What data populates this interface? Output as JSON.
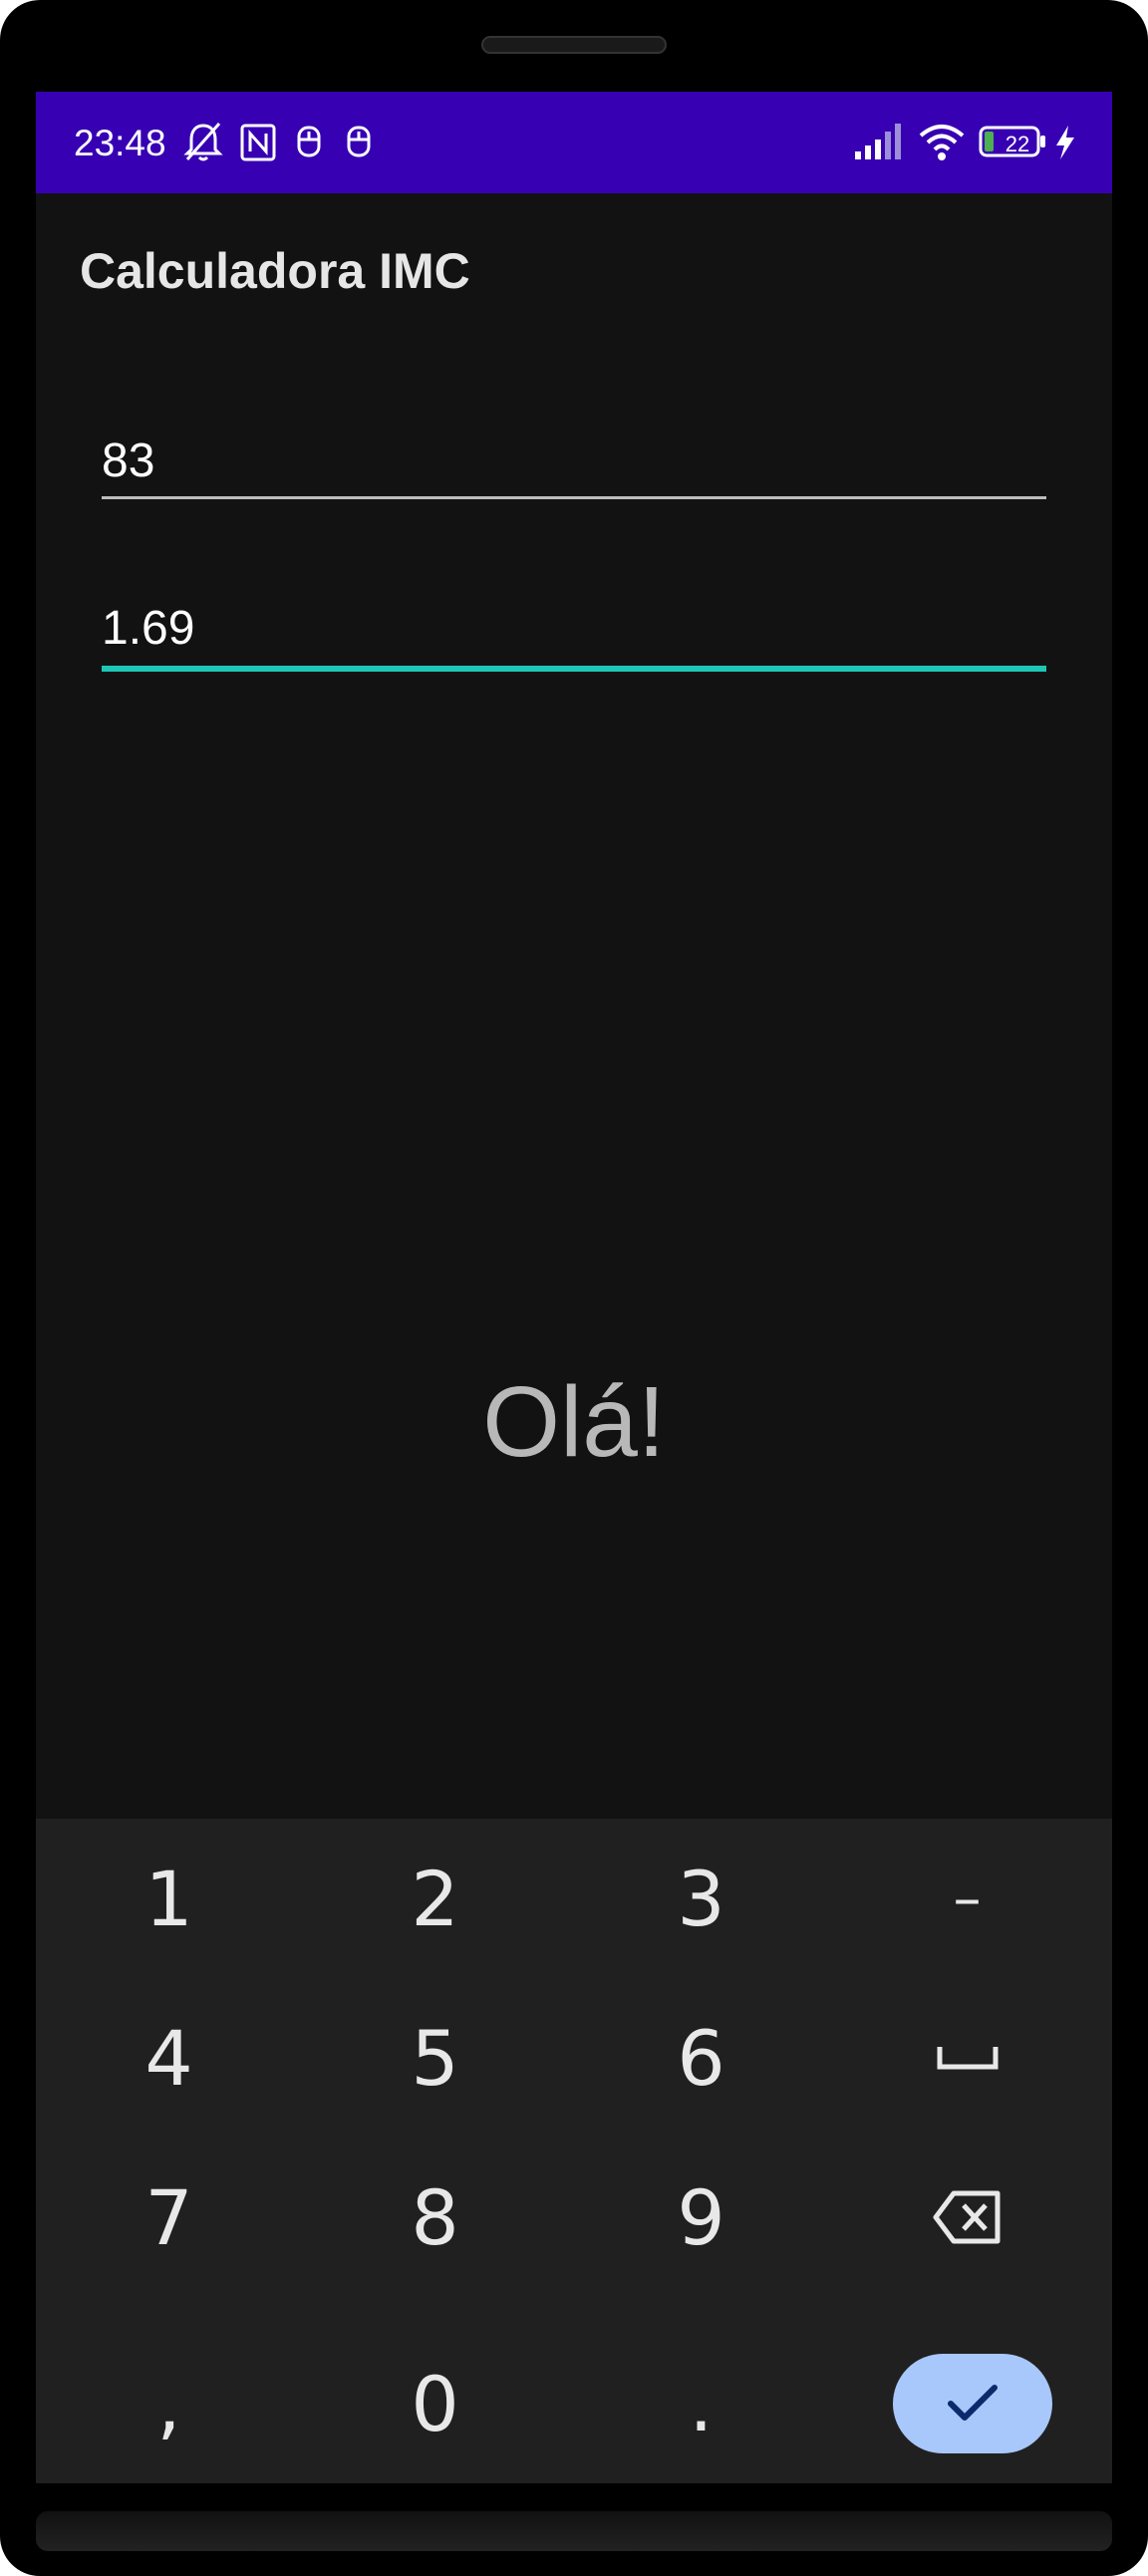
{
  "status_bar": {
    "time": "23:48",
    "battery_level": "22",
    "icons": [
      "mute-bell-icon",
      "nfc-icon",
      "app-notification-icon",
      "app-notification-icon",
      "signal-icon",
      "wifi-icon",
      "battery-icon",
      "charging-bolt-icon"
    ],
    "background_color": "#3700b3"
  },
  "app": {
    "title": "Calculadora IMC"
  },
  "form": {
    "weight_value": "83",
    "height_value": "1.69",
    "focused_line_color": "#1ec6b6"
  },
  "result": {
    "message": "Olá!"
  },
  "keyboard": {
    "rows": [
      [
        "1",
        "2",
        "3",
        "–"
      ],
      [
        "4",
        "5",
        "6",
        "space"
      ],
      [
        "7",
        "8",
        "9",
        "backspace"
      ],
      [
        ",",
        "0",
        ".",
        "done"
      ]
    ],
    "done_color": "#a8c7fa"
  }
}
